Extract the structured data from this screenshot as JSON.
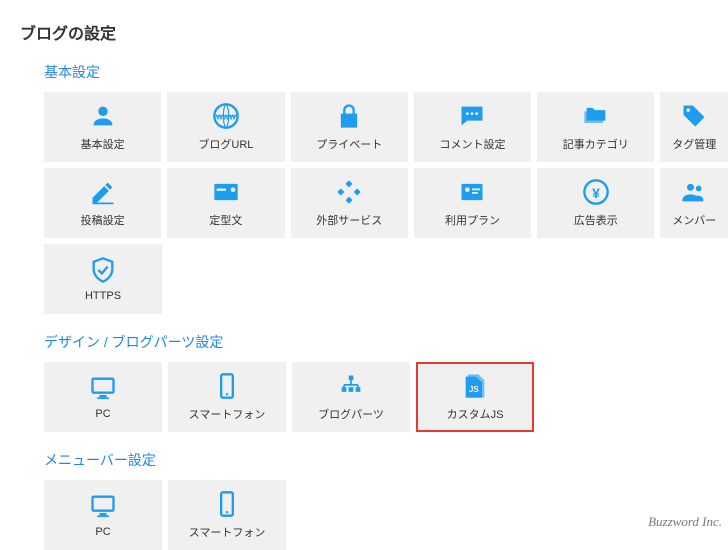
{
  "page_title": "ブログの設定",
  "sections": {
    "basic": {
      "title": "基本設定",
      "items": [
        {
          "label": "基本設定",
          "icon": "person-icon"
        },
        {
          "label": "ブログURL",
          "icon": "www-icon"
        },
        {
          "label": "プライベート",
          "icon": "lock-icon"
        },
        {
          "label": "コメント設定",
          "icon": "comment-icon"
        },
        {
          "label": "記事カテゴリ",
          "icon": "folders-icon"
        },
        {
          "label": "タグ管理",
          "icon": "tag-icon"
        },
        {
          "label": "投稿設定",
          "icon": "edit-icon"
        },
        {
          "label": "定型文",
          "icon": "card-icon"
        },
        {
          "label": "外部サービス",
          "icon": "external-icon"
        },
        {
          "label": "利用プラン",
          "icon": "plan-icon"
        },
        {
          "label": "広告表示",
          "icon": "yen-icon"
        },
        {
          "label": "メンバー",
          "icon": "members-icon"
        },
        {
          "label": "HTTPS",
          "icon": "shield-icon"
        }
      ]
    },
    "design": {
      "title": "デザイン / ブログパーツ設定",
      "items": [
        {
          "label": "PC",
          "icon": "monitor-icon"
        },
        {
          "label": "スマートフォン",
          "icon": "phone-icon"
        },
        {
          "label": "ブログパーツ",
          "icon": "parts-icon"
        },
        {
          "label": "カスタムJS",
          "icon": "js-icon",
          "highlight": true
        }
      ]
    },
    "menubar": {
      "title": "メニューバー設定",
      "items": [
        {
          "label": "PC",
          "icon": "monitor-icon"
        },
        {
          "label": "スマートフォン",
          "icon": "phone-icon"
        }
      ]
    }
  },
  "footer_brand": "Buzzword Inc.",
  "colors": {
    "accent": "#1e9cef",
    "heading": "#1e88e5",
    "highlight_border": "#e53935",
    "tile_bg": "#f0f0f0"
  }
}
